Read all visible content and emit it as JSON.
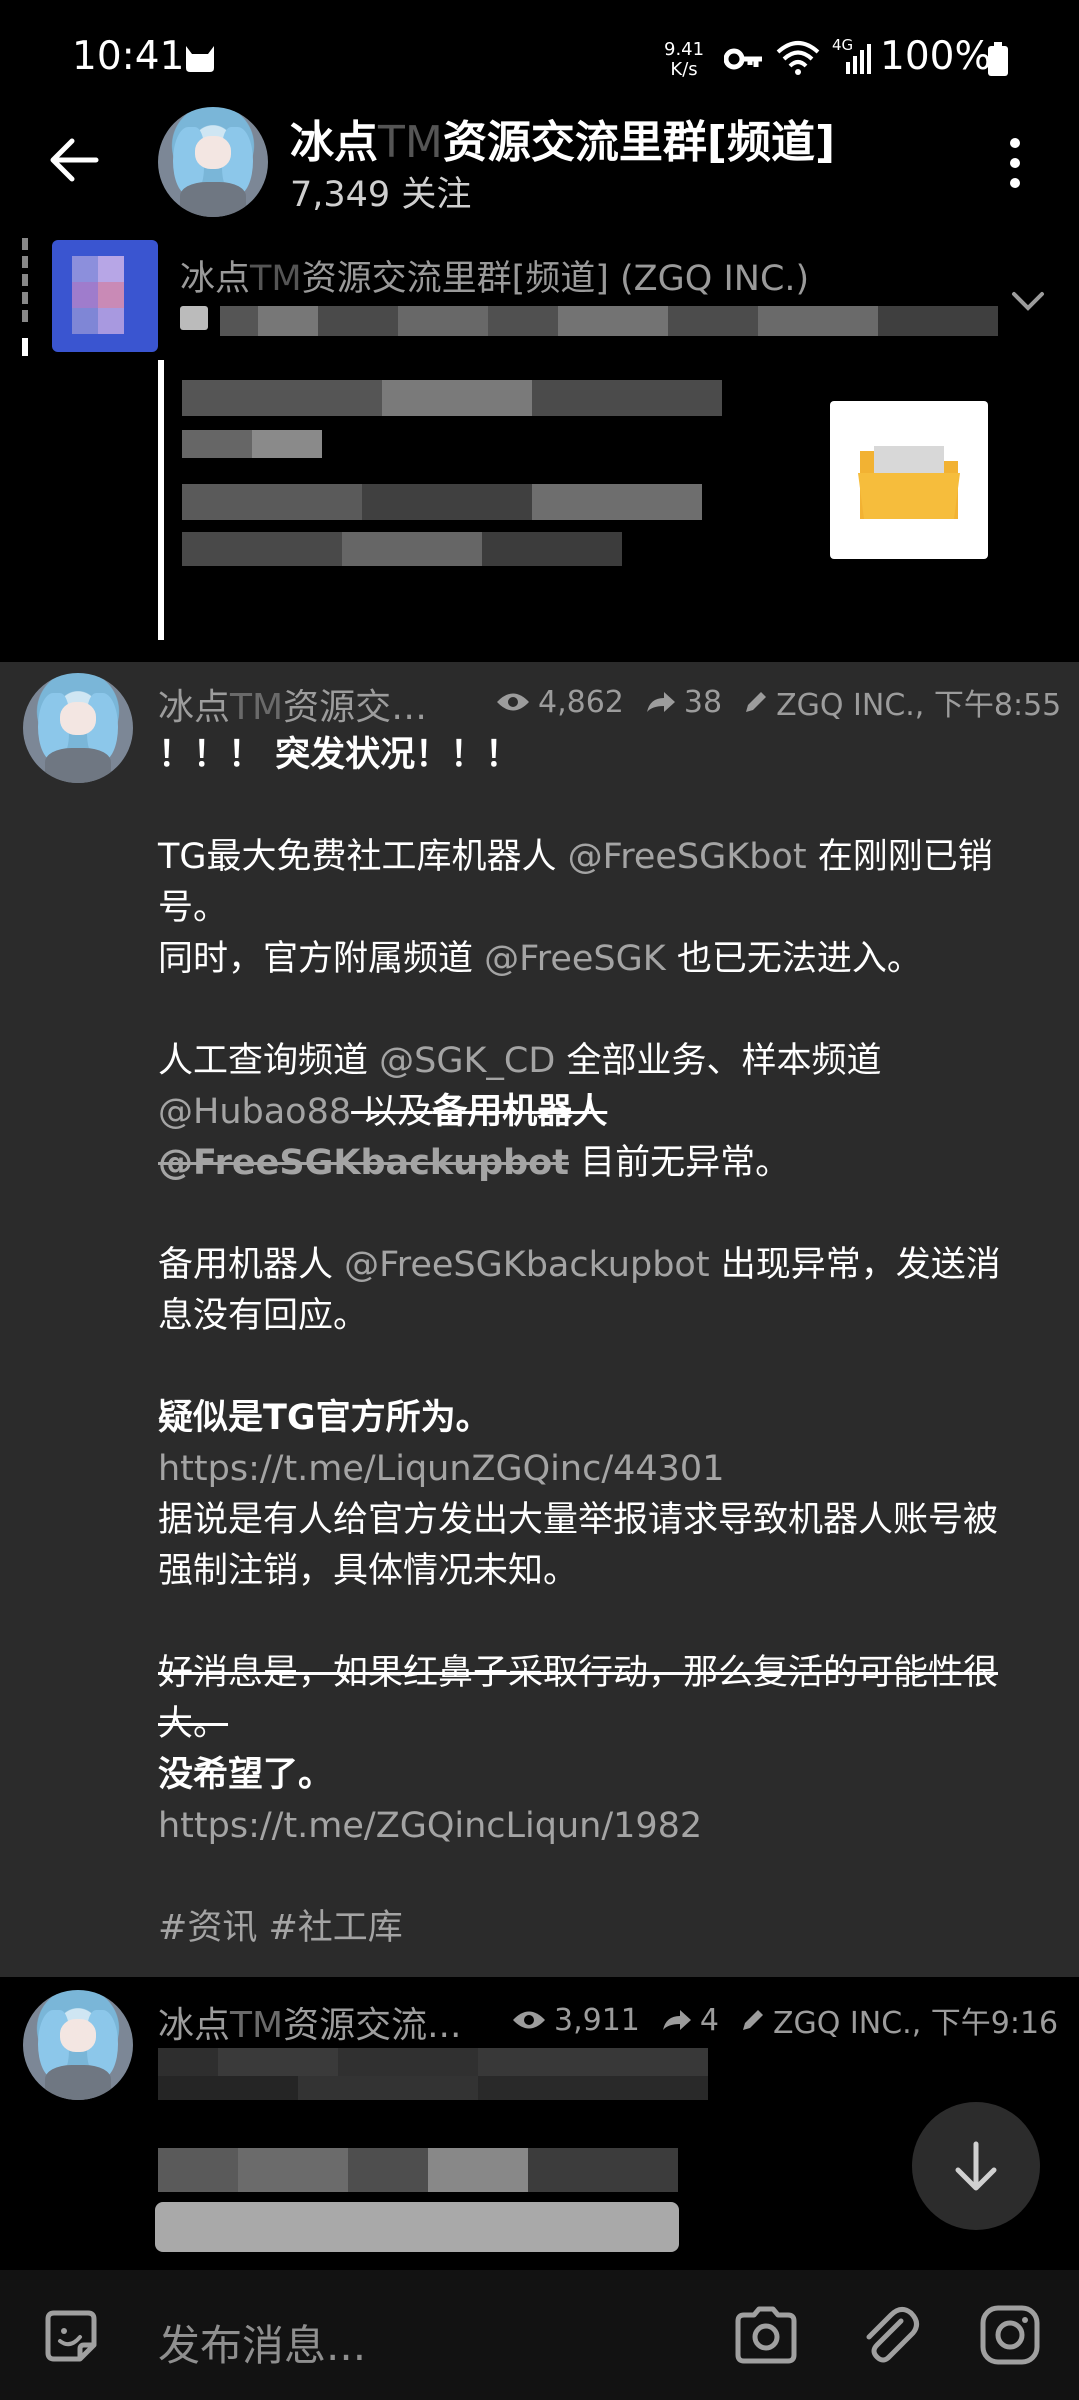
{
  "status_bar": {
    "time": "10:41",
    "net_speed_value": "9.41",
    "net_speed_unit": "K/s",
    "network": "4G",
    "battery": "100%"
  },
  "header": {
    "title_prefix": "冰点",
    "title_tm": "TM",
    "title_suffix": "资源交流里群[频道]",
    "subscribers": "7,349 关注"
  },
  "pinned": {
    "title_prefix": "冰点",
    "title_tm": "TM",
    "title_suffix": "资源交流里群[频道] (ZGQ INC.)"
  },
  "message1": {
    "name_prefix": "冰点",
    "name_tm": "TM",
    "name_suffix": "资源交…",
    "views": "4,862",
    "forwards": "38",
    "signature": "ZGQ INC., 下午8:55",
    "alert": "！！！ 突发状况！！！",
    "p1_pre": "TG最大免费社工库机器人 ",
    "p1_mention": "@FreeSGKbot",
    "p1_post": " 在刚刚已销号。",
    "p2_pre": "同时，官方附属频道 ",
    "p2_mention": "@FreeSGK",
    "p2_post": " 也已无法进入。",
    "p3_pre": "人工查询频道 ",
    "p3_mention1": "@SGK_CD",
    "p3_mid": " 全部业务、样本频道 ",
    "p3_mention2": "@Hubao88",
    "p3_strike1": " 以及",
    "p3_strike_bold": "备用机器人",
    "p3_strike_space": " ",
    "p3_strike_mention": "@FreeSGKbackupbot",
    "p3_post": " 目前无异常。",
    "p4_pre": "备用机器人 ",
    "p4_mention": "@FreeSGKbackupbot",
    "p4_post": " 出现异常，发送消息没有回应。",
    "p5_bold": "疑似是TG官方所为。",
    "p5_link": "https://t.me/LiqunZGQinc/44301",
    "p5_text": "据说是有人给官方发出大量举报请求导致机器人账号被强制注销，具体情况未知。",
    "p6_strike": "好消息是，如果红鼻子采取行动，那么复活的可能性很大。",
    "p6_bold": "没希望了。",
    "p6_link": "https://t.me/ZGQincLiqun/1982",
    "tags": "#资讯 #社工库"
  },
  "message2": {
    "name_prefix": "冰点",
    "name_tm": "TM",
    "name_suffix": "资源交流...",
    "views": "3,911",
    "forwards": "4",
    "signature": "ZGQ INC., 下午9:16"
  },
  "input": {
    "placeholder": "发布消息..."
  },
  "icons": {
    "back": "arrow-left-icon",
    "menu": "more-vertical-icon",
    "views": "eye-icon",
    "forwards": "share-arrow-icon",
    "signature": "pencil-icon",
    "scroll": "arrow-down-icon",
    "sticker": "sticker-icon",
    "camera": "camera-icon",
    "attach": "paperclip-icon",
    "instagram": "instagram-icon"
  },
  "colors": {
    "background": "#000000",
    "message_bg": "#2b2b2b",
    "text": "#ffffff",
    "muted": "#9c9c9c",
    "link": "#a4a4a4"
  }
}
